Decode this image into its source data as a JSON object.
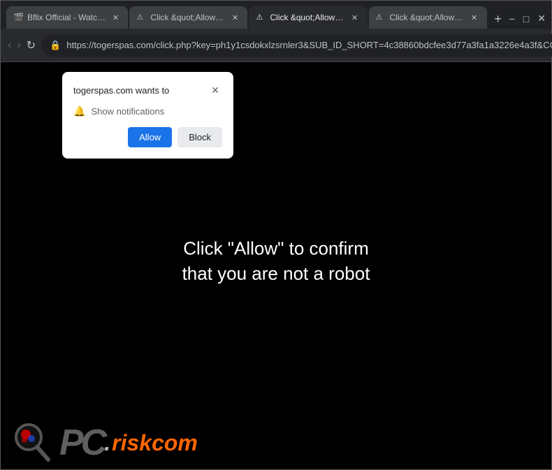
{
  "browser": {
    "tabs": [
      {
        "id": "tab1",
        "title": "Bflix Official - Watch M...",
        "active": false,
        "favicon": "🎬"
      },
      {
        "id": "tab2",
        "title": "Click &quot;Allow&qu...",
        "active": false,
        "favicon": "⚠️"
      },
      {
        "id": "tab3",
        "title": "Click &quot;Allow&qu...",
        "active": true,
        "favicon": "⚠️"
      },
      {
        "id": "tab4",
        "title": "Click &quot;Allow&qu...",
        "active": false,
        "favicon": "⚠️"
      }
    ],
    "url": "https://togerspas.com/click.php?key=ph1y1csdokxlzsrnler3&SUB_ID_SHORT=4c38860bdcfee3d77a3fa1a3226e4a3f&CO...",
    "new_tab_label": "+",
    "window_controls": {
      "minimize": "−",
      "maximize": "□",
      "close": "✕"
    }
  },
  "nav": {
    "back_label": "‹",
    "forward_label": "›",
    "refresh_label": "↻"
  },
  "notification_dialog": {
    "title": "togerspas.com wants to",
    "close_label": "✕",
    "permission_text": "Show notifications",
    "allow_label": "Allow",
    "block_label": "Block"
  },
  "page": {
    "main_text_line1": "Click \"Allow\" to confirm",
    "main_text_line2": "that you are not a robot"
  },
  "watermark": {
    "pc_text": "PC",
    "dot_text": ".",
    "risk_text": "risk",
    "com_text": "com"
  }
}
